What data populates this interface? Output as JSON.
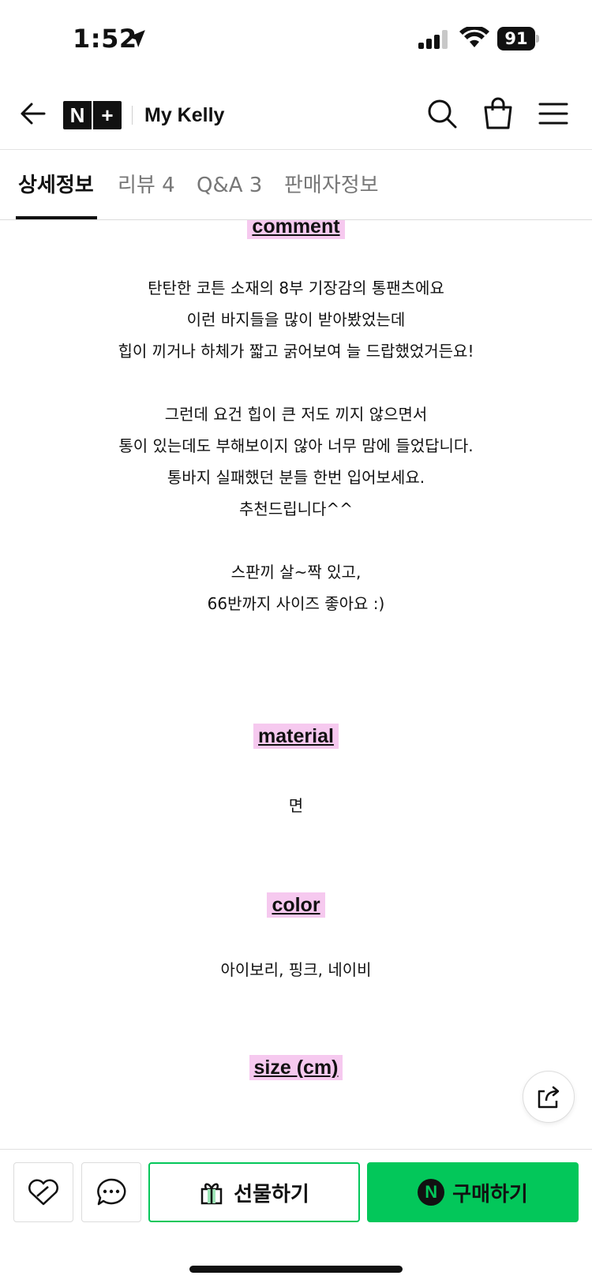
{
  "status_bar": {
    "time": "1:52",
    "battery": "91"
  },
  "header": {
    "store_name": "My Kelly",
    "logo_left": "N",
    "logo_right": "+"
  },
  "tabs": [
    {
      "label": "상세정보"
    },
    {
      "label": "리뷰 4"
    },
    {
      "label": "Q&A 3"
    },
    {
      "label": "판매자정보"
    }
  ],
  "content": {
    "comment_title": "comment",
    "comment_lines": [
      "탄탄한 코튼 소재의 8부 기장감의 통팬츠에요",
      "이런 바지들을 많이 받아봤었는데",
      "힙이 끼거나 하체가 짧고 굵어보여 늘 드랍했었거든요!",
      "그런데 요건 힙이 큰 저도 끼지 않으면서",
      "통이 있는데도 부해보이지 않아 너무 맘에 들었답니다.",
      "통바지 실패했던 분들 한번 입어보세요.",
      "추천드립니다^^",
      "스판끼 살~짝 있고,",
      "66반까지 사이즈 좋아요 :)"
    ],
    "material_title": "material",
    "material_value": "면",
    "color_title": "color",
    "color_value": "아이보리, 핑크, 네이비",
    "size_title": "size (cm)"
  },
  "bottom_bar": {
    "gift_label": "선물하기",
    "buy_label": "구매하기",
    "npay_badge": "N"
  },
  "colors": {
    "accent": "#03c75a",
    "highlight": "#f6c9ef"
  }
}
